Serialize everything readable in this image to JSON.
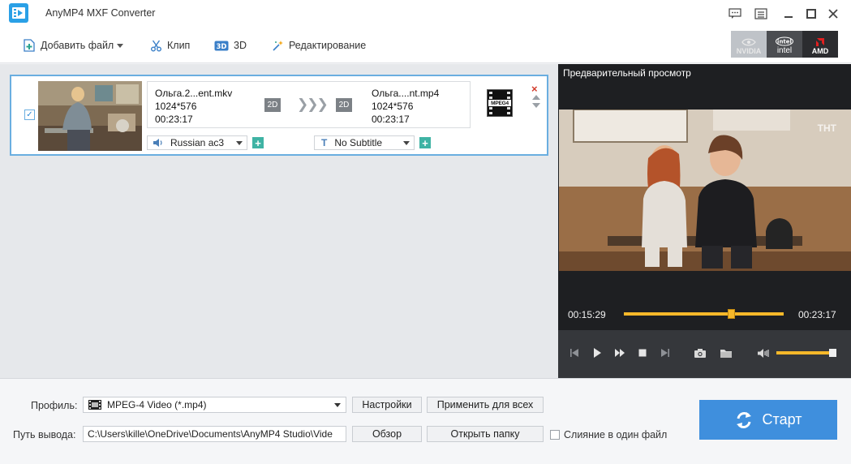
{
  "window": {
    "title": "AnyMP4 MXF Converter",
    "icons": [
      "feedback-icon",
      "menu-icon",
      "minimize-icon",
      "maximize-icon",
      "close-icon"
    ]
  },
  "toolbar": {
    "add_file": "Добавить файл",
    "clip": "Клип",
    "three_d": "3D",
    "edit": "Редактирование",
    "gpu": {
      "nvidia": "NVIDIA",
      "intel": "intel",
      "amd": "AMD"
    }
  },
  "file_item": {
    "checked": true,
    "source": {
      "name": "Ольга.2...ent.mkv",
      "resolution": "1024*576",
      "duration": "00:23:17",
      "mode": "2D"
    },
    "output": {
      "name": "Ольга....nt.mp4",
      "resolution": "1024*576",
      "duration": "00:23:17",
      "mode": "2D"
    },
    "format_badge": "MPEG4",
    "audio_track": "Russian ac3",
    "subtitle": "No Subtitle",
    "plus_label": "+",
    "close_label": "×"
  },
  "preview": {
    "title": "Предварительный просмотр",
    "current_time": "00:15:29",
    "total_time": "00:23:17",
    "progress": 0.67,
    "volume": 0.93,
    "watermark": "ТНТ"
  },
  "bottom": {
    "profile_label": "Профиль:",
    "profile_value": "MPEG-4 Video (*.mp4)",
    "settings_button": "Настройки",
    "apply_all_button": "Применить для всех",
    "output_label": "Путь вывода:",
    "output_path": "C:\\Users\\kille\\OneDrive\\Documents\\AnyMP4 Studio\\Vide",
    "browse_button": "Обзор",
    "open_folder_button": "Открыть папку",
    "merge_label": "Слияние в один файл",
    "start_button": "Старт"
  },
  "colors": {
    "accent": "#3f8fdd",
    "progress": "#f6b82a",
    "plus": "#3fb3a4",
    "close": "#d23b2b"
  }
}
